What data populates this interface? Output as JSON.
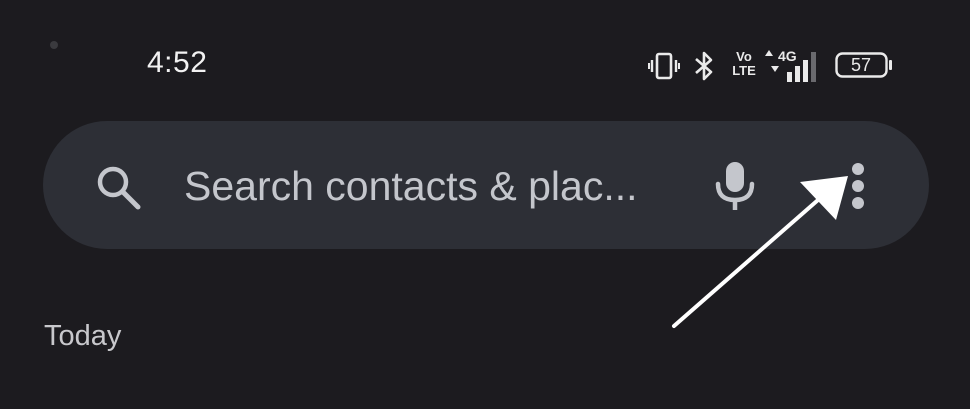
{
  "status_bar": {
    "time": "4:52",
    "network_label": "4G",
    "volte_label_top": "Vo",
    "volte_label_bottom": "LTE",
    "battery_level": "57",
    "icons": [
      "vibrate-icon",
      "bluetooth-icon",
      "volte-icon",
      "signal-4g-icon",
      "battery-icon"
    ]
  },
  "search": {
    "placeholder": "Search contacts & plac...",
    "icons": [
      "search-icon",
      "mic-icon",
      "more-vert-icon"
    ]
  },
  "list": {
    "section_header": "Today"
  },
  "annotation": {
    "arrow_color": "#ffffff",
    "points_to": "more-vert-icon"
  },
  "colors": {
    "background": "#1c1b1f",
    "search_bar": "#2d2f36",
    "placeholder_text": "#c4c6cc",
    "icon": "#c4c6cc"
  }
}
